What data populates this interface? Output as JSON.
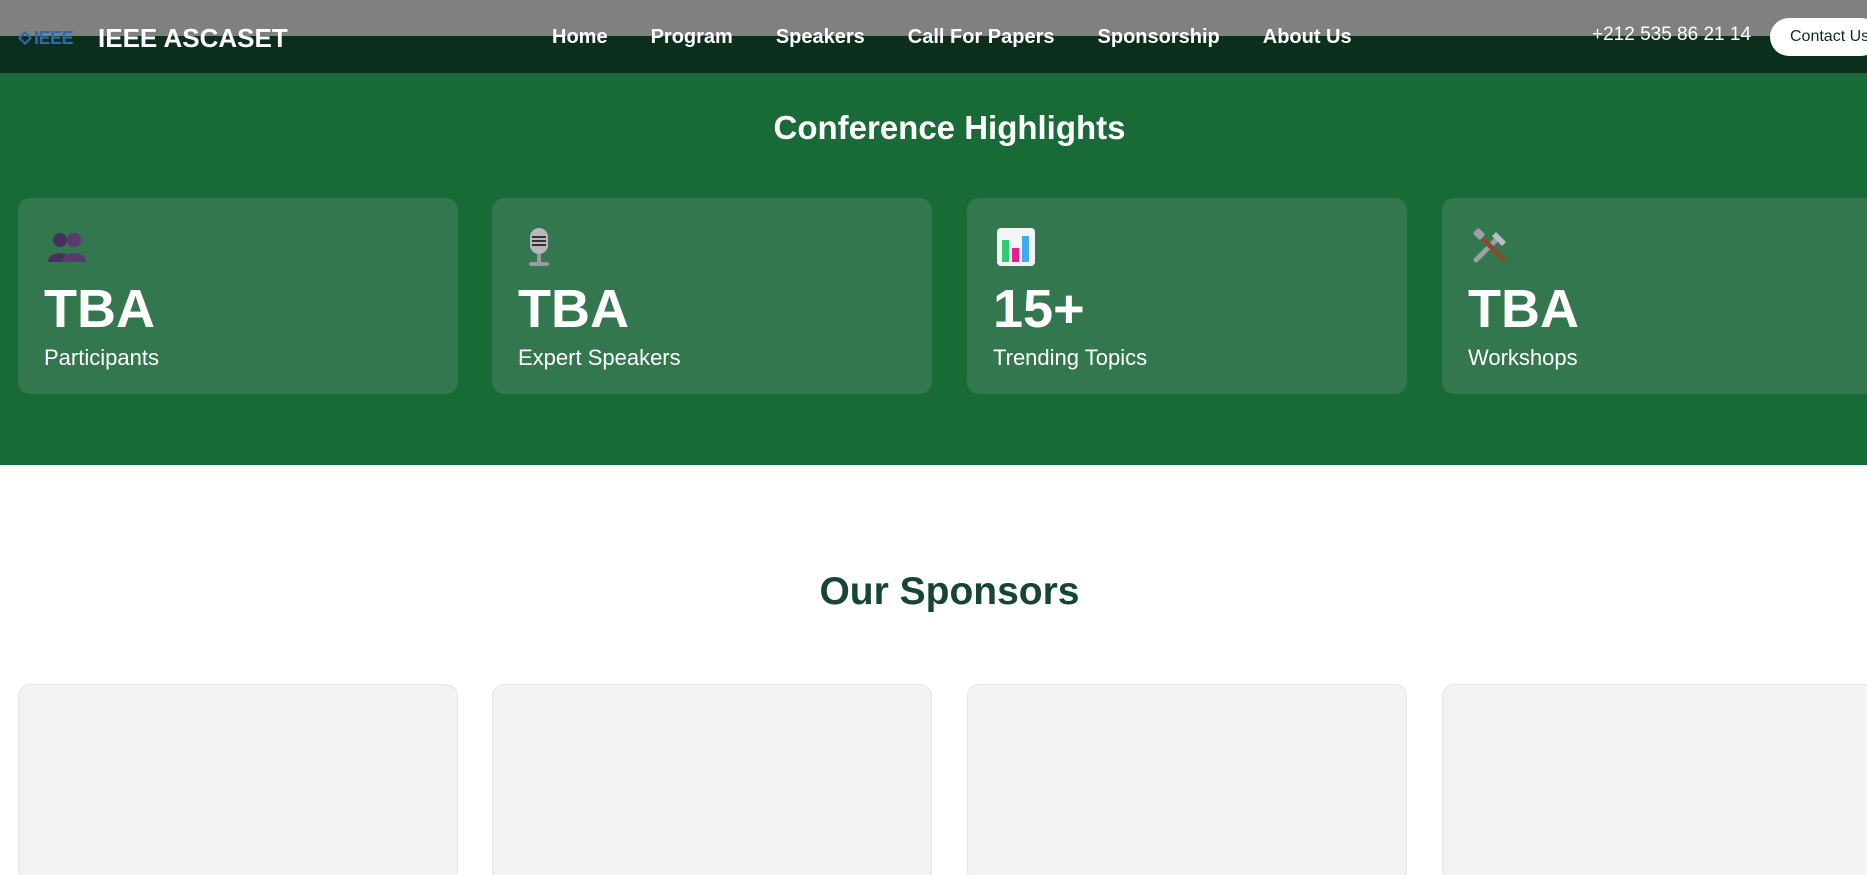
{
  "header": {
    "logo_text": "IEEE",
    "brand_name": "IEEE ASCASET",
    "nav": [
      {
        "label": "Home"
      },
      {
        "label": "Program"
      },
      {
        "label": "Speakers"
      },
      {
        "label": "Call For Papers"
      },
      {
        "label": "Sponsorship"
      },
      {
        "label": "About Us"
      }
    ],
    "phone": "+212 535 86 21 14",
    "contact_label": "Contact Us"
  },
  "highlights": {
    "title": "Conference Highlights",
    "cards": [
      {
        "icon": "participants-icon",
        "value": "TBA",
        "label": "Participants"
      },
      {
        "icon": "microphone-icon",
        "value": "TBA",
        "label": "Expert Speakers"
      },
      {
        "icon": "bar-chart-icon",
        "value": "15+",
        "label": "Trending Topics"
      },
      {
        "icon": "tools-icon",
        "value": "TBA",
        "label": "Workshops"
      }
    ]
  },
  "sponsors": {
    "title": "Our Sponsors"
  },
  "colors": {
    "header_bg": "#0c2e1c",
    "highlights_bg": "#186a37",
    "card_bg": "#32774e",
    "sponsors_title": "#174534",
    "sponsor_card_bg": "#f2f3f5"
  }
}
